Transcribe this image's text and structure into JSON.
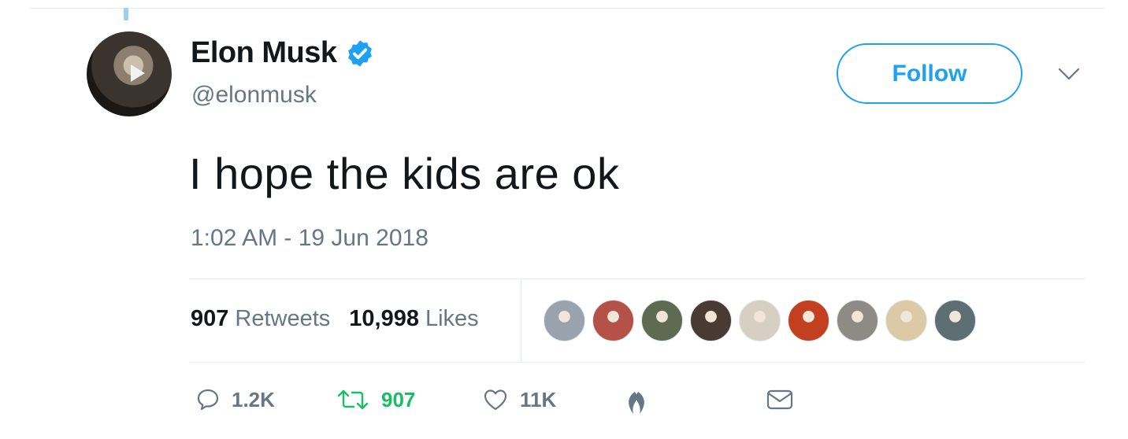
{
  "tweet": {
    "author": {
      "name": "Elon Musk",
      "handle": "@elonmusk",
      "verified": true,
      "avatar_icon": "avatar"
    },
    "follow_label": "Follow",
    "text": "I hope the kids are ok",
    "timestamp": "1:02 AM - 19 Jun 2018",
    "stats": {
      "retweets_count": "907",
      "retweets_label": "Retweets",
      "likes_count": "10,998",
      "likes_label": "Likes"
    },
    "likers": [
      {
        "color": "#9aa3ad"
      },
      {
        "color": "#b4524a"
      },
      {
        "color": "#5e6b52"
      },
      {
        "color": "#4a3a34"
      },
      {
        "color": "#d8cfc3"
      },
      {
        "color": "#c2401f"
      },
      {
        "color": "#8e8a86"
      },
      {
        "color": "#dcc9a5"
      },
      {
        "color": "#5e6f74"
      }
    ],
    "actions": {
      "reply_count": "1.2K",
      "retweet_count": "907",
      "like_count": "11K"
    },
    "colors": {
      "accent": "#1da1f2",
      "retweet": "#17bf63",
      "muted": "#657786"
    }
  }
}
